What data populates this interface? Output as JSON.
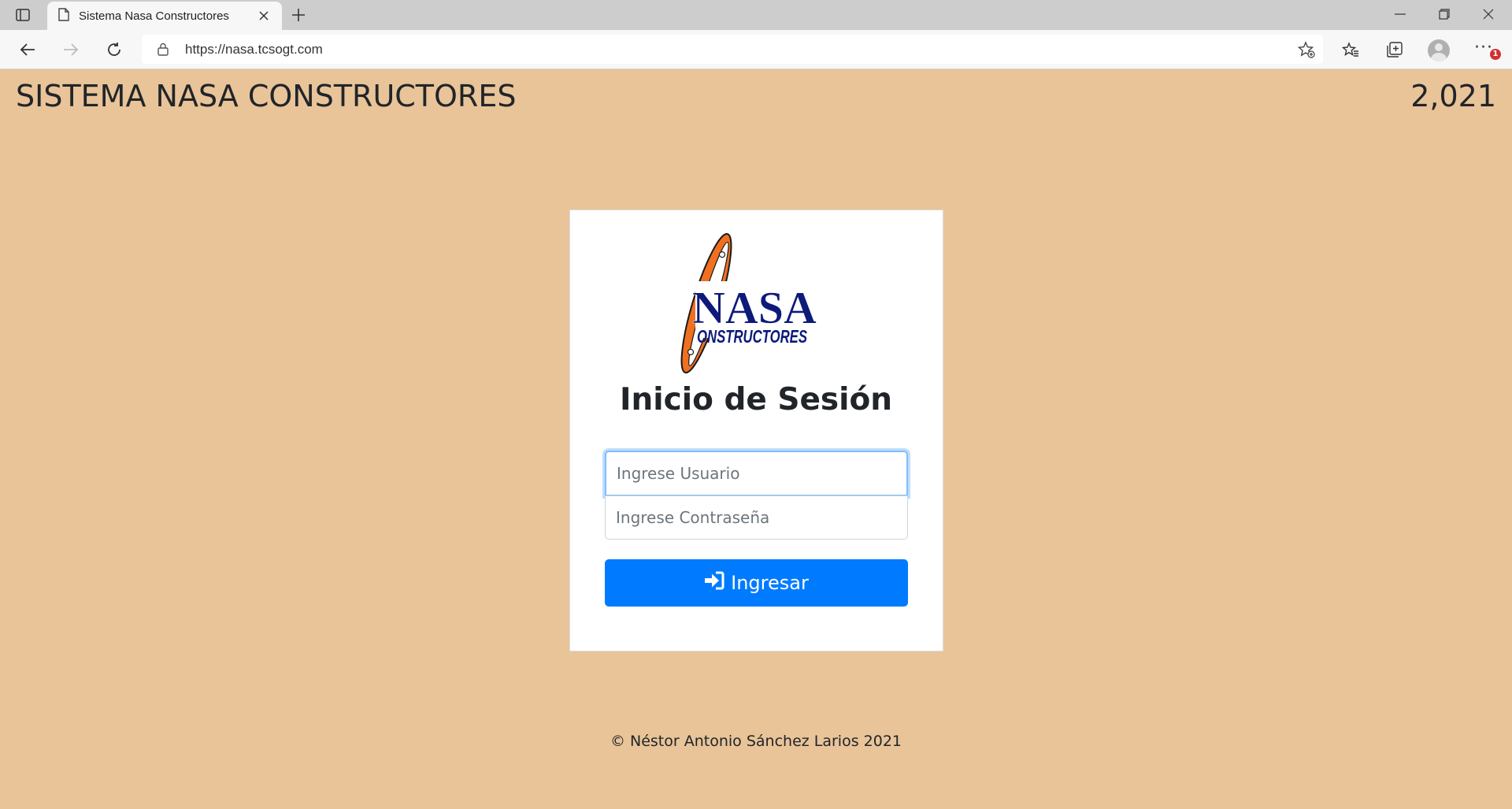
{
  "browser": {
    "tab_title": "Sistema Nasa Constructores",
    "url": "https://nasa.tcsogt.com",
    "notification_count": "1"
  },
  "header": {
    "title": "SISTEMA NASA CONSTRUCTORES",
    "year": "2,021"
  },
  "logo": {
    "word_main": "NASA",
    "word_sub": "ONSTRUCTORES"
  },
  "login": {
    "title": "Inicio de Sesión",
    "user_placeholder": "Ingrese Usuario",
    "password_placeholder": "Ingrese Contraseña",
    "submit_label": "Ingresar"
  },
  "footer": {
    "text": "© Néstor Antonio Sánchez Larios 2021"
  },
  "colors": {
    "page_background": "#e9c499",
    "primary_button": "#007bff",
    "logo_orange": "#f07020",
    "logo_navy": "#0d1a7a"
  }
}
